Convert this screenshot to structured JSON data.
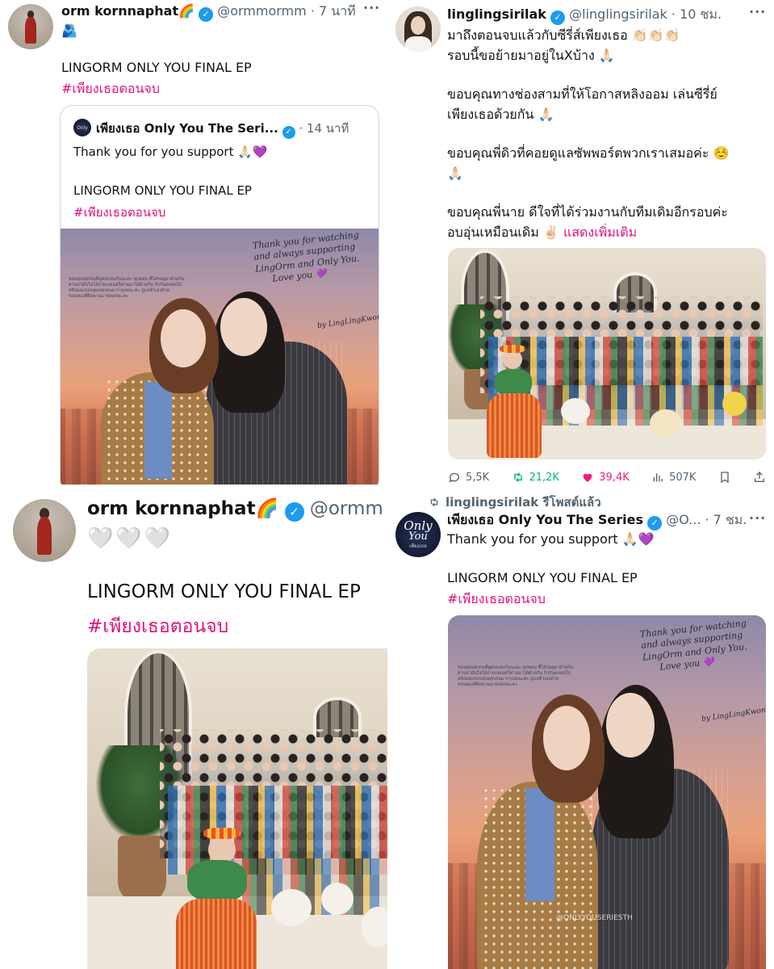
{
  "tl": {
    "name": "orm kornnaphat🌈",
    "handle": "@ormmormm",
    "time": "· 7 นาที",
    "emoji_line": "🫂",
    "text": "LINGORM ONLY YOU FINAL EP",
    "hashtag": "#เพียงเธอตอนจบ",
    "quote": {
      "name": "เพียงเธอ Only You The Seri...",
      "time": "· 14 นาที",
      "text": "Thank you for you support 🙏🏻💜",
      "text2": "LINGORM ONLY YOU FINAL EP",
      "hashtag": "#เพียงเธอตอนจบ"
    }
  },
  "tr": {
    "name": "linglingsirilak",
    "handle": "@linglingsirilak",
    "time": "· 10 ชม.",
    "lines": [
      "มาถึงตอนจบแล้วกับซีรี่ส์เพียงเธอ 👏🏻👏🏻👏🏻",
      "รอบนี้ขอย้ายมาอยู่ในXบ้าง 🙏🏻",
      "",
      "ขอบคุณทางช่องสามที่ให้โอกาสหลิงออม เล่นซีรี่ย์",
      "เพียงเธอด้วยกัน 🙏🏻",
      "",
      "ขอบคุณพี่ดิวที่คอยดูแลซัพพอร์ตพวกเราเสมอค่ะ ☺️",
      "🙏🏻",
      "",
      "ขอบคุณพี่นาย ดีใจที่ได้ร่วมงานกับทีมเดิมอีกรอบค่ะ"
    ],
    "last_line": "อบอุ่นเหมือนเดิม ✌🏻",
    "show_more": "แสดงเพิ่มเติม",
    "stats": {
      "replies": "5,5K",
      "retweets": "21,2K",
      "likes": "39,4K",
      "views": "507K"
    }
  },
  "bl": {
    "name": "orm kornnaphat🌈",
    "handle": "@ormm",
    "hearts": "🤍🤍🤍",
    "text": "LINGORM ONLY YOU FINAL EP",
    "hashtag": "#เพียงเธอตอนจบ"
  },
  "br": {
    "retweeted_by": "linglingsirilak รีโพสต์แล้ว",
    "name": "เพียงเธอ Only You The Series",
    "handle": "@O...",
    "time": "· 7 ชม.",
    "text": "Thank you for you support 🙏🏻💜",
    "text2": "LINGORM ONLY YOU FINAL EP",
    "hashtag": "#เพียงเธอตอนจบ",
    "watermark": "@ONLYYOUSERIESTH"
  },
  "avatar_series": {
    "line1": "Only",
    "line2": "You",
    "line3": "เพียงเธอ"
  },
  "photo_note": {
    "h1": "Thank you for watching",
    "h2": "and always supporting",
    "h3": "LingOrm and Only You.",
    "h4": "Love you 💜",
    "h5": "by LingLingKwong",
    "s1": "ขอบคุณทุกคนที่ดูตอนจบกันนะคะ ทุกตอน ที่ได้รอดูมาด้วยกัน",
    "s2": "ผ่านมามันไม่ได้ง่ายเลยแต่ก็ผ่านมาได้ด้วยกัน รักกันตลอดไป",
    "s3": "หลิงออมขอบคุณทุกคนมากๆเลยนะคะ ดูแลตัวเองด้วย",
    "s4": "ขอบคุณที่ติดตามมาตลอดนะคะ"
  },
  "colors": {
    "hashtag": "#e0127b",
    "verified": "#1d9bf0",
    "like": "#f91880",
    "retweet": "#00ba7c",
    "muted": "#536471"
  },
  "icons": [
    "verified-icon",
    "more-icon",
    "reply-icon",
    "retweet-icon",
    "like-icon",
    "views-icon",
    "bookmark-icon",
    "share-icon"
  ]
}
